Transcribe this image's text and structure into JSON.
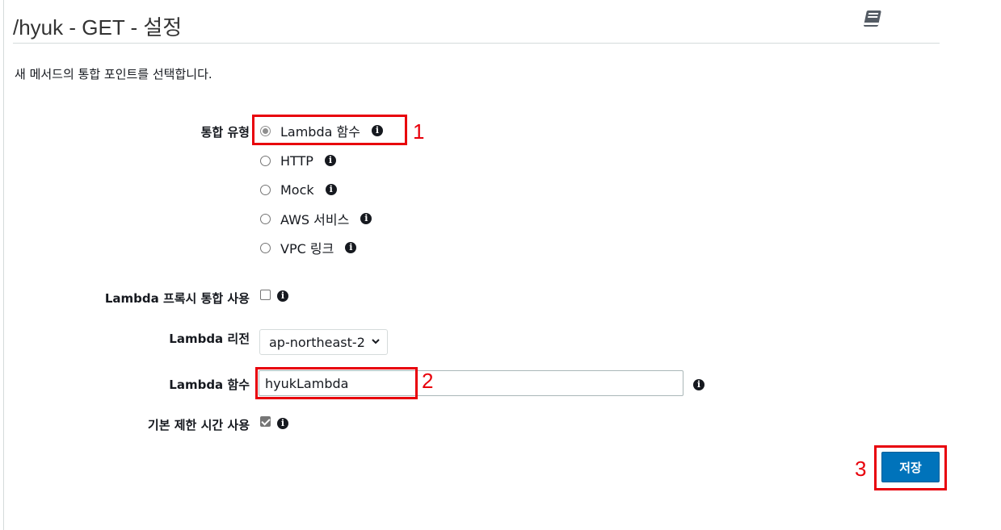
{
  "header": {
    "title": "/hyuk - GET - 설정",
    "description": "새 메서드의 통합 포인트를 선택합니다."
  },
  "form": {
    "integration_type": {
      "label": "통합 유형",
      "options": [
        {
          "label": "Lambda 함수",
          "selected": true
        },
        {
          "label": "HTTP",
          "selected": false
        },
        {
          "label": "Mock",
          "selected": false
        },
        {
          "label": "AWS 서비스",
          "selected": false
        },
        {
          "label": "VPC 링크",
          "selected": false
        }
      ]
    },
    "proxy_integration": {
      "label": "Lambda 프록시 통합 사용",
      "checked": false
    },
    "region": {
      "label": "Lambda 리전",
      "value": "ap-northeast-2"
    },
    "function": {
      "label": "Lambda 함수",
      "value": "hyukLambda"
    },
    "default_timeout": {
      "label": "기본 제한 시간 사용",
      "checked": true
    }
  },
  "actions": {
    "save_label": "저장"
  },
  "annotations": {
    "n1": "1",
    "n2": "2",
    "n3": "3",
    "color": "#e8000b"
  },
  "icons": {
    "docs": "book-icon",
    "info": "info-icon",
    "dropdown": "chevron-down-icon"
  },
  "colors": {
    "primary_button": "#0073bb",
    "text": "#16191f"
  }
}
